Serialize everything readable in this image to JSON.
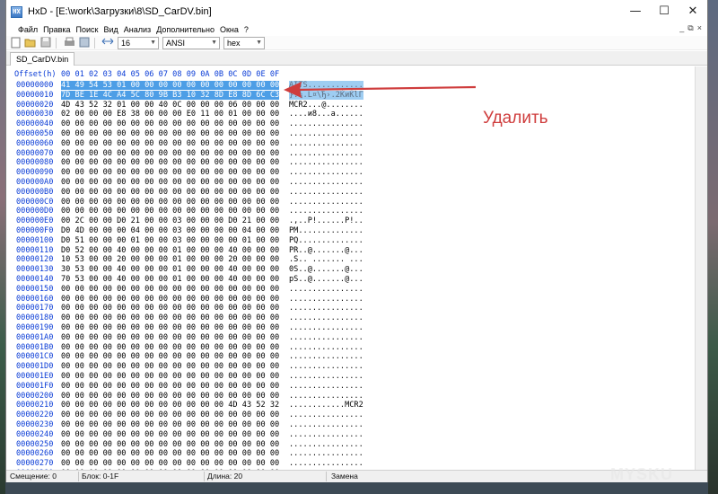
{
  "window": {
    "app_icon": "hxd-app-icon",
    "title": "HxD - [E:\\work\\Загрузки\\8\\SD_CarDV.bin]",
    "buttons": {
      "minimize": "—",
      "maximize": "☐",
      "close": "✕"
    }
  },
  "menubar": {
    "items": [
      "Файл",
      "Правка",
      "Поиск",
      "Вид",
      "Анализ",
      "Дополнительно",
      "Окна",
      "?"
    ],
    "mdi_buttons": [
      "_",
      "⧉",
      "×"
    ]
  },
  "toolbar": {
    "icons": [
      "new-file-icon",
      "open-file-icon",
      "save-file-icon",
      "print-icon",
      "properties-icon",
      "bytes-per-row-icon"
    ],
    "bytes_per_row": "16",
    "charset": "ANSI",
    "display_mode": "hex"
  },
  "tab": {
    "label": "SD_CarDV.bin"
  },
  "editor": {
    "header_offset": "Offset(h)",
    "header_columns": "00 01 02 03 04 05 06 07 08 09 0A 0B 0C 0D 0E 0F",
    "rows": [
      {
        "offset": "00000000",
        "hex": "41 49 54 53 01 00 00 00 00 00 00 00 00 00 00 00",
        "ascii": "AITS............",
        "selected": true
      },
      {
        "offset": "00000010",
        "hex": "7D BE 1E 4C A4 5C 80 9B B3 10 32 8D E8 8D 6C C3",
        "ascii": "}.¾.L¤\\Ђ›.2ЌиЌlГ",
        "selected": true
      },
      {
        "offset": "00000020",
        "hex": "4D 43 52 32 01 00 00 40 0C 00 00 00 06 00 00 00",
        "ascii": "MCR2...@........"
      },
      {
        "offset": "00000030",
        "hex": "02 00 00 00 E8 38 00 00 00 E0 11 00 01 00 00 00",
        "ascii": "....и8...а......"
      },
      {
        "offset": "00000040",
        "hex": "00 00 00 00 00 00 00 00 00 00 00 00 00 00 00 00",
        "ascii": "................"
      },
      {
        "offset": "00000050",
        "hex": "00 00 00 00 00 00 00 00 00 00 00 00 00 00 00 00",
        "ascii": "................"
      },
      {
        "offset": "00000060",
        "hex": "00 00 00 00 00 00 00 00 00 00 00 00 00 00 00 00",
        "ascii": "................"
      },
      {
        "offset": "00000070",
        "hex": "00 00 00 00 00 00 00 00 00 00 00 00 00 00 00 00",
        "ascii": "................"
      },
      {
        "offset": "00000080",
        "hex": "00 00 00 00 00 00 00 00 00 00 00 00 00 00 00 00",
        "ascii": "................"
      },
      {
        "offset": "00000090",
        "hex": "00 00 00 00 00 00 00 00 00 00 00 00 00 00 00 00",
        "ascii": "................"
      },
      {
        "offset": "000000A0",
        "hex": "00 00 00 00 00 00 00 00 00 00 00 00 00 00 00 00",
        "ascii": "................"
      },
      {
        "offset": "000000B0",
        "hex": "00 00 00 00 00 00 00 00 00 00 00 00 00 00 00 00",
        "ascii": "................"
      },
      {
        "offset": "000000C0",
        "hex": "00 00 00 00 00 00 00 00 00 00 00 00 00 00 00 00",
        "ascii": "................"
      },
      {
        "offset": "000000D0",
        "hex": "00 00 00 00 00 00 00 00 00 00 00 00 00 00 00 00",
        "ascii": "................"
      },
      {
        "offset": "000000E0",
        "hex": "00 2C 00 00 D0 21 00 00 03 00 00 00 D0 21 00 00",
        "ascii": ".,..Р!......Р!.."
      },
      {
        "offset": "000000F0",
        "hex": "D0 4D 00 00 00 04 00 00 03 00 00 00 00 04 00 00",
        "ascii": "РM.............."
      },
      {
        "offset": "00000100",
        "hex": "D0 51 00 00 00 01 00 00 03 00 00 00 00 01 00 00",
        "ascii": "РQ.............."
      },
      {
        "offset": "00000110",
        "hex": "D0 52 00 00 40 00 00 00 01 00 00 00 40 00 00 00",
        "ascii": "РR..@.......@..."
      },
      {
        "offset": "00000120",
        "hex": "10 53 00 00 20 00 00 00 01 00 00 00 20 00 00 00",
        "ascii": ".S.. ....... ..."
      },
      {
        "offset": "00000130",
        "hex": "30 53 00 00 40 00 00 00 01 00 00 00 40 00 00 00",
        "ascii": "0S..@.......@..."
      },
      {
        "offset": "00000140",
        "hex": "70 53 00 00 40 00 00 00 01 00 00 00 40 00 00 00",
        "ascii": "pS..@.......@..."
      },
      {
        "offset": "00000150",
        "hex": "00 00 00 00 00 00 00 00 00 00 00 00 00 00 00 00",
        "ascii": "................"
      },
      {
        "offset": "00000160",
        "hex": "00 00 00 00 00 00 00 00 00 00 00 00 00 00 00 00",
        "ascii": "................"
      },
      {
        "offset": "00000170",
        "hex": "00 00 00 00 00 00 00 00 00 00 00 00 00 00 00 00",
        "ascii": "................"
      },
      {
        "offset": "00000180",
        "hex": "00 00 00 00 00 00 00 00 00 00 00 00 00 00 00 00",
        "ascii": "................"
      },
      {
        "offset": "00000190",
        "hex": "00 00 00 00 00 00 00 00 00 00 00 00 00 00 00 00",
        "ascii": "................"
      },
      {
        "offset": "000001A0",
        "hex": "00 00 00 00 00 00 00 00 00 00 00 00 00 00 00 00",
        "ascii": "................"
      },
      {
        "offset": "000001B0",
        "hex": "00 00 00 00 00 00 00 00 00 00 00 00 00 00 00 00",
        "ascii": "................"
      },
      {
        "offset": "000001C0",
        "hex": "00 00 00 00 00 00 00 00 00 00 00 00 00 00 00 00",
        "ascii": "................"
      },
      {
        "offset": "000001D0",
        "hex": "00 00 00 00 00 00 00 00 00 00 00 00 00 00 00 00",
        "ascii": "................"
      },
      {
        "offset": "000001E0",
        "hex": "00 00 00 00 00 00 00 00 00 00 00 00 00 00 00 00",
        "ascii": "................"
      },
      {
        "offset": "000001F0",
        "hex": "00 00 00 00 00 00 00 00 00 00 00 00 00 00 00 00",
        "ascii": "................"
      },
      {
        "offset": "00000200",
        "hex": "00 00 00 00 00 00 00 00 00 00 00 00 00 00 00 00",
        "ascii": "................"
      },
      {
        "offset": "00000210",
        "hex": "00 00 00 00 00 00 00 00 00 00 00 00 4D 43 52 32",
        "ascii": "............MCR2"
      },
      {
        "offset": "00000220",
        "hex": "00 00 00 00 00 00 00 00 00 00 00 00 00 00 00 00",
        "ascii": "................"
      },
      {
        "offset": "00000230",
        "hex": "00 00 00 00 00 00 00 00 00 00 00 00 00 00 00 00",
        "ascii": "................"
      },
      {
        "offset": "00000240",
        "hex": "00 00 00 00 00 00 00 00 00 00 00 00 00 00 00 00",
        "ascii": "................"
      },
      {
        "offset": "00000250",
        "hex": "00 00 00 00 00 00 00 00 00 00 00 00 00 00 00 00",
        "ascii": "................"
      },
      {
        "offset": "00000260",
        "hex": "00 00 00 00 00 00 00 00 00 00 00 00 00 00 00 00",
        "ascii": "................"
      },
      {
        "offset": "00000270",
        "hex": "00 00 00 00 00 00 00 00 00 00 00 00 00 00 00 00",
        "ascii": "................"
      },
      {
        "offset": "00000280",
        "hex": "00 00 00 00 00 00 00 00 00 00 00 00 00 00 00 00",
        "ascii": "................"
      }
    ]
  },
  "statusbar": {
    "offset": "Смещение: 0",
    "block": "Блок: 0-1F",
    "length": "Длина: 20",
    "mode": "Замена"
  },
  "annotation": {
    "text": "Удалить",
    "color": "#cf3d3d"
  },
  "watermark": {
    "text": "MYSKU"
  },
  "colors": {
    "selection": "#4d9ee6",
    "offset_text": "#0a3cd6"
  }
}
